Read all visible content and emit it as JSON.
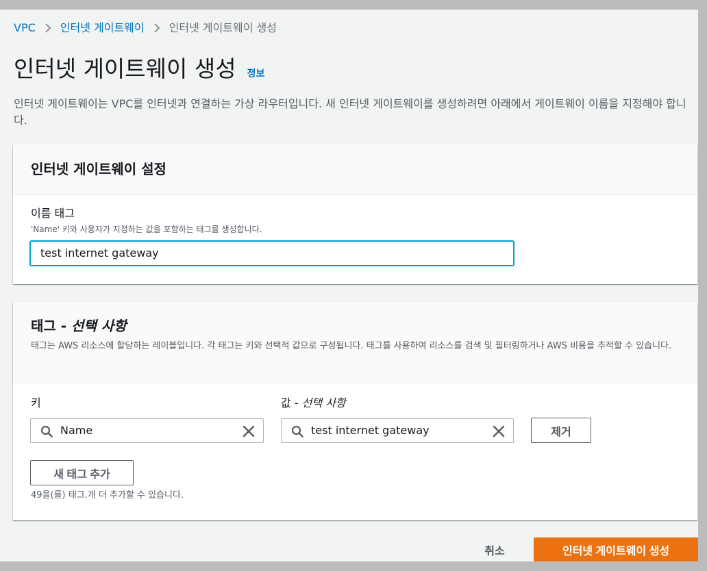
{
  "breadcrumb": {
    "items": [
      "VPC",
      "인터넷 게이트웨이",
      "인터넷 게이트웨이 생성"
    ]
  },
  "header": {
    "title": "인터넷 게이트웨이 생성",
    "info_link": "정보",
    "description": "인터넷 게이트웨이는 VPC를 인터넷과 연결하는 가상 라우터입니다. 새 인터넷 게이트웨이를 생성하려면 아래에서 게이트웨이 이름을 지정해야 합니다."
  },
  "settings": {
    "title": "인터넷 게이트웨이 설정",
    "name_tag_label": "이름 태그",
    "name_tag_description": "'Name' 키와 사용자가 지정하는 값을 포함하는 태그를 생성합니다.",
    "name_tag_value": "test internet gateway"
  },
  "tags": {
    "title_main": "태그 - ",
    "title_optional": "선택 사항",
    "description": "태그는 AWS 리소스에 할당하는 레이블입니다. 각 태그는 키와 선택적 값으로 구성됩니다. 태그를 사용하여 리소스를 검색 및 필터링하거나 AWS 비용을 추적할 수 있습니다.",
    "key_label": "키",
    "value_label_main": "값 - ",
    "value_label_optional": "선택 사항",
    "rows": [
      {
        "key": "Name",
        "value": "test internet gateway",
        "remove_label": "제거"
      }
    ],
    "add_button": "새 태그 추가",
    "limit_note": "49을(를) 태그.개 더 추가할 수 있습니다."
  },
  "actions": {
    "cancel": "취소",
    "submit": "인터넷 게이트웨이 생성"
  },
  "colors": {
    "link": "#0073bb",
    "primary": "#ec7211",
    "focus": "#00a1c9",
    "background": "#f2f3f3"
  },
  "icons": [
    "chevron-right-icon",
    "search-icon",
    "close-icon"
  ]
}
